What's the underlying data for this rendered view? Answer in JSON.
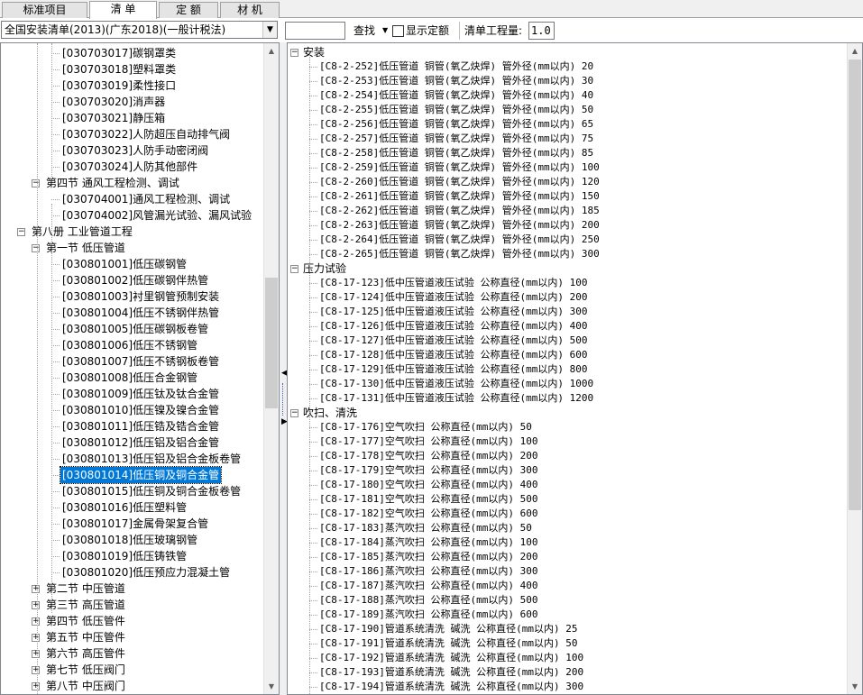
{
  "tabs": [
    {
      "label": "标准项目",
      "active": false
    },
    {
      "label": "清  单",
      "active": true
    },
    {
      "label": "定  额",
      "active": false
    },
    {
      "label": "材  机",
      "active": false
    }
  ],
  "library_select": {
    "value": "全国安装清单(2013)(广东2018)(一般计税法)"
  },
  "search": {
    "value": "",
    "find_label": "查找",
    "show_quota_label": "显示定额",
    "show_quota_checked": false
  },
  "quantity": {
    "label": "清单工程量:",
    "value": "1.0"
  },
  "left_tree": [
    {
      "depth": 3,
      "label": "[030703017]碳钢罩类"
    },
    {
      "depth": 3,
      "label": "[030703018]塑料罩类"
    },
    {
      "depth": 3,
      "label": "[030703019]柔性接口"
    },
    {
      "depth": 3,
      "label": "[030703020]消声器"
    },
    {
      "depth": 3,
      "label": "[030703021]静压箱"
    },
    {
      "depth": 3,
      "label": "[030703022]人防超压自动排气阀"
    },
    {
      "depth": 3,
      "label": "[030703023]人防手动密闭阀"
    },
    {
      "depth": 3,
      "label": "[030703024]人防其他部件"
    },
    {
      "depth": 2,
      "label": "第四节  通风工程检测、调试",
      "expander": "−"
    },
    {
      "depth": 3,
      "label": "[030704001]通风工程检测、调试"
    },
    {
      "depth": 3,
      "label": "[030704002]风管漏光试验、漏风试验"
    },
    {
      "depth": 1,
      "label": "第八册  工业管道工程",
      "expander": "−"
    },
    {
      "depth": 2,
      "label": "第一节  低压管道",
      "expander": "−"
    },
    {
      "depth": 3,
      "label": "[030801001]低压碳钢管"
    },
    {
      "depth": 3,
      "label": "[030801002]低压碳钢伴热管"
    },
    {
      "depth": 3,
      "label": "[030801003]衬里钢管预制安装"
    },
    {
      "depth": 3,
      "label": "[030801004]低压不锈钢伴热管"
    },
    {
      "depth": 3,
      "label": "[030801005]低压碳钢板卷管"
    },
    {
      "depth": 3,
      "label": "[030801006]低压不锈钢管"
    },
    {
      "depth": 3,
      "label": "[030801007]低压不锈钢板卷管"
    },
    {
      "depth": 3,
      "label": "[030801008]低压合金钢管"
    },
    {
      "depth": 3,
      "label": "[030801009]低压钛及钛合金管"
    },
    {
      "depth": 3,
      "label": "[030801010]低压镍及镍合金管"
    },
    {
      "depth": 3,
      "label": "[030801011]低压锆及锆合金管"
    },
    {
      "depth": 3,
      "label": "[030801012]低压铝及铝合金管"
    },
    {
      "depth": 3,
      "label": "[030801013]低压铝及铝合金板卷管"
    },
    {
      "depth": 3,
      "label": "[030801014]低压铜及铜合金管",
      "selected": true
    },
    {
      "depth": 3,
      "label": "[030801015]低压铜及铜合金板卷管"
    },
    {
      "depth": 3,
      "label": "[030801016]低压塑料管"
    },
    {
      "depth": 3,
      "label": "[030801017]金属骨架复合管"
    },
    {
      "depth": 3,
      "label": "[030801018]低压玻璃钢管"
    },
    {
      "depth": 3,
      "label": "[030801019]低压铸铁管"
    },
    {
      "depth": 3,
      "label": "[030801020]低压预应力混凝土管"
    },
    {
      "depth": 2,
      "label": "第二节  中压管道",
      "expander": "+"
    },
    {
      "depth": 2,
      "label": "第三节  高压管道",
      "expander": "+"
    },
    {
      "depth": 2,
      "label": "第四节  低压管件",
      "expander": "+"
    },
    {
      "depth": 2,
      "label": "第五节  中压管件",
      "expander": "+"
    },
    {
      "depth": 2,
      "label": "第六节  高压管件",
      "expander": "+"
    },
    {
      "depth": 2,
      "label": "第七节  低压阀门",
      "expander": "+"
    },
    {
      "depth": 2,
      "label": "第八节  中压阀门",
      "expander": "+"
    }
  ],
  "right_tree": [
    {
      "type": "group",
      "label": "安装"
    },
    {
      "label": "[C8-2-252]低压管道 铜管(氧乙炔焊) 管外径(mm以内) 20"
    },
    {
      "label": "[C8-2-253]低压管道 铜管(氧乙炔焊) 管外径(mm以内) 30"
    },
    {
      "label": "[C8-2-254]低压管道 铜管(氧乙炔焊) 管外径(mm以内) 40"
    },
    {
      "label": "[C8-2-255]低压管道 铜管(氧乙炔焊) 管外径(mm以内) 50"
    },
    {
      "label": "[C8-2-256]低压管道 铜管(氧乙炔焊) 管外径(mm以内) 65"
    },
    {
      "label": "[C8-2-257]低压管道 铜管(氧乙炔焊) 管外径(mm以内) 75"
    },
    {
      "label": "[C8-2-258]低压管道 铜管(氧乙炔焊) 管外径(mm以内) 85"
    },
    {
      "label": "[C8-2-259]低压管道 铜管(氧乙炔焊) 管外径(mm以内) 100"
    },
    {
      "label": "[C8-2-260]低压管道 铜管(氧乙炔焊) 管外径(mm以内) 120"
    },
    {
      "label": "[C8-2-261]低压管道 铜管(氧乙炔焊) 管外径(mm以内) 150"
    },
    {
      "label": "[C8-2-262]低压管道 铜管(氧乙炔焊) 管外径(mm以内) 185"
    },
    {
      "label": "[C8-2-263]低压管道 铜管(氧乙炔焊) 管外径(mm以内) 200"
    },
    {
      "label": "[C8-2-264]低压管道 铜管(氧乙炔焊) 管外径(mm以内) 250"
    },
    {
      "label": "[C8-2-265]低压管道 铜管(氧乙炔焊) 管外径(mm以内) 300"
    },
    {
      "type": "group",
      "label": "压力试验"
    },
    {
      "label": "[C8-17-123]低中压管道液压试验 公称直径(mm以内) 100"
    },
    {
      "label": "[C8-17-124]低中压管道液压试验 公称直径(mm以内) 200"
    },
    {
      "label": "[C8-17-125]低中压管道液压试验 公称直径(mm以内) 300"
    },
    {
      "label": "[C8-17-126]低中压管道液压试验 公称直径(mm以内) 400"
    },
    {
      "label": "[C8-17-127]低中压管道液压试验 公称直径(mm以内) 500"
    },
    {
      "label": "[C8-17-128]低中压管道液压试验 公称直径(mm以内) 600"
    },
    {
      "label": "[C8-17-129]低中压管道液压试验 公称直径(mm以内) 800"
    },
    {
      "label": "[C8-17-130]低中压管道液压试验 公称直径(mm以内) 1000"
    },
    {
      "label": "[C8-17-131]低中压管道液压试验 公称直径(mm以内) 1200"
    },
    {
      "type": "group",
      "label": "吹扫、清洗"
    },
    {
      "label": "[C8-17-176]空气吹扫 公称直径(mm以内) 50"
    },
    {
      "label": "[C8-17-177]空气吹扫 公称直径(mm以内) 100"
    },
    {
      "label": "[C8-17-178]空气吹扫 公称直径(mm以内) 200"
    },
    {
      "label": "[C8-17-179]空气吹扫 公称直径(mm以内) 300"
    },
    {
      "label": "[C8-17-180]空气吹扫 公称直径(mm以内) 400"
    },
    {
      "label": "[C8-17-181]空气吹扫 公称直径(mm以内) 500"
    },
    {
      "label": "[C8-17-182]空气吹扫 公称直径(mm以内) 600"
    },
    {
      "label": "[C8-17-183]蒸汽吹扫 公称直径(mm以内) 50"
    },
    {
      "label": "[C8-17-184]蒸汽吹扫 公称直径(mm以内) 100"
    },
    {
      "label": "[C8-17-185]蒸汽吹扫 公称直径(mm以内) 200"
    },
    {
      "label": "[C8-17-186]蒸汽吹扫 公称直径(mm以内) 300"
    },
    {
      "label": "[C8-17-187]蒸汽吹扫 公称直径(mm以内) 400"
    },
    {
      "label": "[C8-17-188]蒸汽吹扫 公称直径(mm以内) 500"
    },
    {
      "label": "[C8-17-189]蒸汽吹扫 公称直径(mm以内) 600"
    },
    {
      "label": "[C8-17-190]管道系统清洗 碱洗 公称直径(mm以内) 25"
    },
    {
      "label": "[C8-17-191]管道系统清洗 碱洗 公称直径(mm以内) 50"
    },
    {
      "label": "[C8-17-192]管道系统清洗 碱洗 公称直径(mm以内) 100"
    },
    {
      "label": "[C8-17-193]管道系统清洗 碱洗 公称直径(mm以内) 200"
    },
    {
      "label": "[C8-17-194]管道系统清洗 碱洗 公称直径(mm以内) 300"
    }
  ],
  "colors": {
    "selection": "#0078d7",
    "scroll_thumb": "#cdcdcd",
    "border": "#828790"
  },
  "icons": {
    "dropdown": "chevron-down-icon",
    "expand": "plus-box-icon",
    "collapse": "minus-box-icon",
    "scroll_up": "arrow-up-icon",
    "scroll_down": "arrow-down-icon"
  }
}
